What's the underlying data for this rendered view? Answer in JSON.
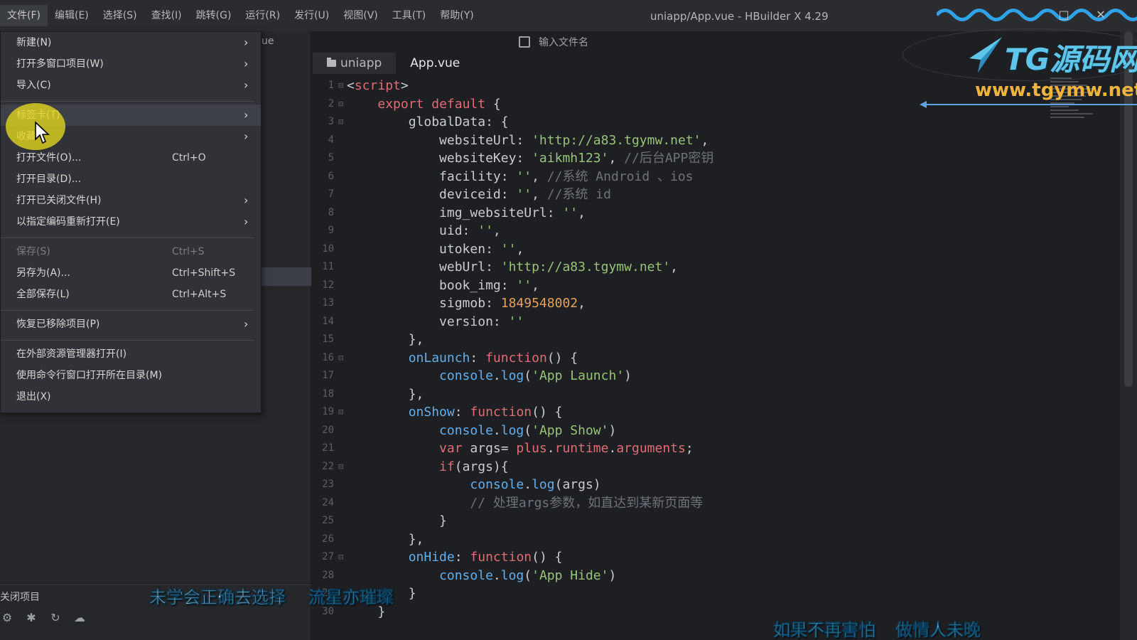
{
  "menubar": {
    "items": [
      "文件(F)",
      "编辑(E)",
      "选择(S)",
      "查找(I)",
      "跳转(G)",
      "运行(R)",
      "发行(U)",
      "视图(V)",
      "工具(T)",
      "帮助(Y)"
    ],
    "window_title": "uniapp/App.vue - HBuilder X 4.29"
  },
  "sidebar": {
    "tab_partial": "ue",
    "bottom_label": "关闭项目"
  },
  "search": {
    "placeholder": "输入文件名"
  },
  "tabs": [
    {
      "label": "uniapp",
      "icon": "folder-icon"
    },
    {
      "label": "App.vue"
    }
  ],
  "file_menu": {
    "items": [
      {
        "label": "新建(N)",
        "shortcut": "",
        "submenu": true
      },
      {
        "label": "打开多窗口项目(W)",
        "shortcut": "",
        "submenu": true
      },
      {
        "label": "导入(C)",
        "shortcut": "",
        "submenu": true
      },
      {
        "label": "标签卡(T)",
        "shortcut": "",
        "submenu": true
      },
      {
        "label": "收藏",
        "shortcut": "",
        "submenu": true
      },
      {
        "label": "打开文件(O)...",
        "shortcut": "Ctrl+O",
        "submenu": false
      },
      {
        "label": "打开目录(D)...",
        "shortcut": "",
        "submenu": false
      },
      {
        "label": "打开已关闭文件(H)",
        "shortcut": "",
        "submenu": true
      },
      {
        "label": "以指定编码重新打开(E)",
        "shortcut": "",
        "submenu": true
      },
      {
        "label": "保存(S)",
        "shortcut": "Ctrl+S",
        "submenu": false
      },
      {
        "label": "另存为(A)...",
        "shortcut": "Ctrl+Shift+S",
        "submenu": false
      },
      {
        "label": "全部保存(L)",
        "shortcut": "Ctrl+Alt+S",
        "submenu": false
      },
      {
        "label": "恢复已移除项目(P)",
        "shortcut": "",
        "submenu": true
      },
      {
        "label": "在外部资源管理器打开(I)",
        "shortcut": "",
        "submenu": false
      },
      {
        "label": "使用命令行窗口打开所在目录(M)",
        "shortcut": "",
        "submenu": false
      },
      {
        "label": "退出(X)",
        "shortcut": "",
        "submenu": false
      }
    ]
  },
  "editor": {
    "lines": [
      {
        "n": "1",
        "code": "<script>"
      },
      {
        "n": "2",
        "code": "    export default {"
      },
      {
        "n": "3",
        "code": "        globalData: {"
      },
      {
        "n": "4",
        "code": "            websiteUrl: 'http://a83.tgymw.net',"
      },
      {
        "n": "5",
        "code": "            websiteKey: 'aikmh123', //后台APP密钥"
      },
      {
        "n": "6",
        "code": "            facility: '', //系统 Android 、ios"
      },
      {
        "n": "7",
        "code": "            deviceid: '', //系统 id"
      },
      {
        "n": "8",
        "code": "            img_websiteUrl: '',"
      },
      {
        "n": "9",
        "code": "            uid: '',"
      },
      {
        "n": "10",
        "code": "            utoken: '',"
      },
      {
        "n": "11",
        "code": "            webUrl: 'http://a83.tgymw.net',"
      },
      {
        "n": "12",
        "code": "            book_img: '',"
      },
      {
        "n": "13",
        "code": "            sigmob: 1849548002,"
      },
      {
        "n": "14",
        "code": "            version: ''"
      },
      {
        "n": "15",
        "code": "        },"
      },
      {
        "n": "16",
        "code": "        onLaunch: function() {"
      },
      {
        "n": "17",
        "code": "            console.log('App Launch')"
      },
      {
        "n": "18",
        "code": "        },"
      },
      {
        "n": "19",
        "code": "        onShow: function() {"
      },
      {
        "n": "20",
        "code": "            console.log('App Show')"
      },
      {
        "n": "21",
        "code": "            var args= plus.runtime.arguments;"
      },
      {
        "n": "22",
        "code": "            if(args){"
      },
      {
        "n": "23",
        "code": "                console.log(args)"
      },
      {
        "n": "24",
        "code": "                // 处理args参数，如直达到某新页面等"
      },
      {
        "n": "25",
        "code": "            }"
      },
      {
        "n": "26",
        "code": "        },"
      },
      {
        "n": "27",
        "code": "        onHide: function() {"
      },
      {
        "n": "28",
        "code": "            console.log('App Hide')"
      },
      {
        "n": "29",
        "code": "        }"
      },
      {
        "n": "30",
        "code": "    }"
      }
    ]
  },
  "watermark": {
    "brand": "TG源码网",
    "url": "www.tgymw.net"
  },
  "subtitles": {
    "left": "未学会正确去选择",
    "left2": "流星亦璀璨",
    "right": "如果不再害怕",
    "right2": "做情人未晚"
  },
  "colors": {
    "keyword": "#e06c75",
    "string": "#98c379",
    "number": "#e5a15c",
    "comment": "#6d737a",
    "function": "#61afef"
  }
}
